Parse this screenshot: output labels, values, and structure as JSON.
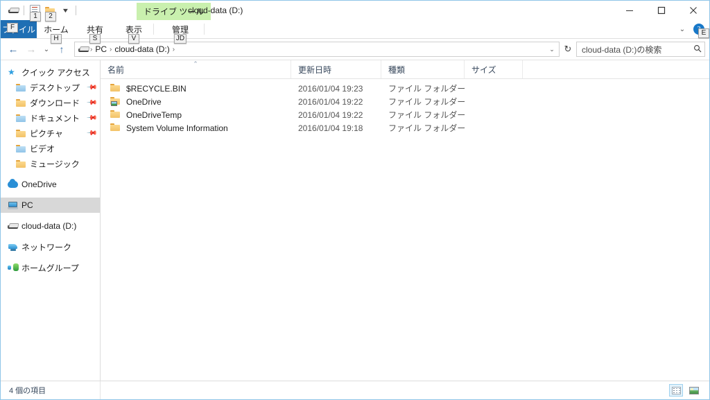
{
  "window": {
    "title": "cloud-data (D:)",
    "contextual_tab": "ドライブ ツール",
    "controls": {
      "minimize": "minimize",
      "maximize": "maximize",
      "close": "close"
    }
  },
  "quick_access_toolbar": {
    "items": [
      {
        "name": "drive-icon",
        "keytip": ""
      },
      {
        "name": "properties-icon",
        "keytip": "1"
      },
      {
        "name": "new-folder-icon",
        "keytip": "2"
      }
    ],
    "customize_label": "▼"
  },
  "ribbon": {
    "tabs": [
      {
        "label": "ファイル",
        "keytip": "F",
        "active": true
      },
      {
        "label": "ホーム",
        "keytip": "H",
        "active": false
      },
      {
        "label": "共有",
        "keytip": "S",
        "active": false
      },
      {
        "label": "表示",
        "keytip": "V",
        "active": false
      },
      {
        "label": "管理",
        "keytip": "JD",
        "active": false
      }
    ],
    "collapse_label": "⌄",
    "help_label": "?",
    "help_keytip": "E"
  },
  "navigation": {
    "back_label": "←",
    "forward_label": "→",
    "recent_label": "⌄",
    "up_label": "↑",
    "refresh_label": "↻",
    "breadcrumb": {
      "drive_icon": "drive-icon",
      "separator": "›",
      "items": [
        "PC",
        "cloud-data (D:)"
      ],
      "dropdown_label": "⌄"
    }
  },
  "search": {
    "placeholder": "cloud-data (D:)の検索",
    "icon": "search-icon"
  },
  "sidebar": {
    "items": [
      {
        "label": "クイック アクセス",
        "icon": "star-icon",
        "indent": false,
        "pinned": false,
        "selected": false
      },
      {
        "label": "デスクトップ",
        "icon": "folder-icon",
        "indent": true,
        "pinned": true,
        "selected": false
      },
      {
        "label": "ダウンロード",
        "icon": "downloads-folder-icon",
        "indent": true,
        "pinned": true,
        "selected": false
      },
      {
        "label": "ドキュメント",
        "icon": "documents-folder-icon",
        "indent": true,
        "pinned": true,
        "selected": false
      },
      {
        "label": "ピクチャ",
        "icon": "pictures-folder-icon",
        "indent": true,
        "pinned": true,
        "selected": false
      },
      {
        "label": "ビデオ",
        "icon": "videos-folder-icon",
        "indent": true,
        "pinned": false,
        "selected": false
      },
      {
        "label": "ミュージック",
        "icon": "music-folder-icon",
        "indent": true,
        "pinned": false,
        "selected": false
      },
      {
        "label": "OneDrive",
        "icon": "cloud-icon",
        "indent": false,
        "pinned": false,
        "selected": false
      },
      {
        "label": "PC",
        "icon": "pc-icon",
        "indent": false,
        "pinned": false,
        "selected": true
      },
      {
        "label": "cloud-data (D:)",
        "icon": "drive-icon",
        "indent": false,
        "pinned": false,
        "selected": false
      },
      {
        "label": "ネットワーク",
        "icon": "network-icon",
        "indent": false,
        "pinned": false,
        "selected": false
      },
      {
        "label": "ホームグループ",
        "icon": "homegroup-icon",
        "indent": false,
        "pinned": false,
        "selected": false
      }
    ],
    "pin_icon": "pin-icon"
  },
  "file_list": {
    "columns": [
      {
        "label": "名前",
        "sorted": "asc"
      },
      {
        "label": "更新日時",
        "sorted": ""
      },
      {
        "label": "種類",
        "sorted": ""
      },
      {
        "label": "サイズ",
        "sorted": ""
      }
    ],
    "sort_caret": "⌃",
    "rows": [
      {
        "name": "$RECYCLE.BIN",
        "date": "2016/01/04 19:23",
        "type": "ファイル フォルダー",
        "size": "",
        "icon": "folder-icon"
      },
      {
        "name": "OneDrive",
        "date": "2016/01/04 19:22",
        "type": "ファイル フォルダー",
        "size": "",
        "icon": "pictures-folder-icon"
      },
      {
        "name": "OneDriveTemp",
        "date": "2016/01/04 19:22",
        "type": "ファイル フォルダー",
        "size": "",
        "icon": "folder-icon"
      },
      {
        "name": "System Volume Information",
        "date": "2016/01/04 19:18",
        "type": "ファイル フォルダー",
        "size": "",
        "icon": "folder-icon"
      }
    ]
  },
  "status_bar": {
    "item_count": "4 個の項目",
    "views": [
      {
        "name": "details-view",
        "active": true
      },
      {
        "name": "large-icons-view",
        "active": false
      }
    ]
  },
  "colors": {
    "accent": "#1f6fb4",
    "contextual_tab": "#c9f0ae",
    "selection": "#d8d8d8",
    "window_border": "#8fc4e8"
  }
}
